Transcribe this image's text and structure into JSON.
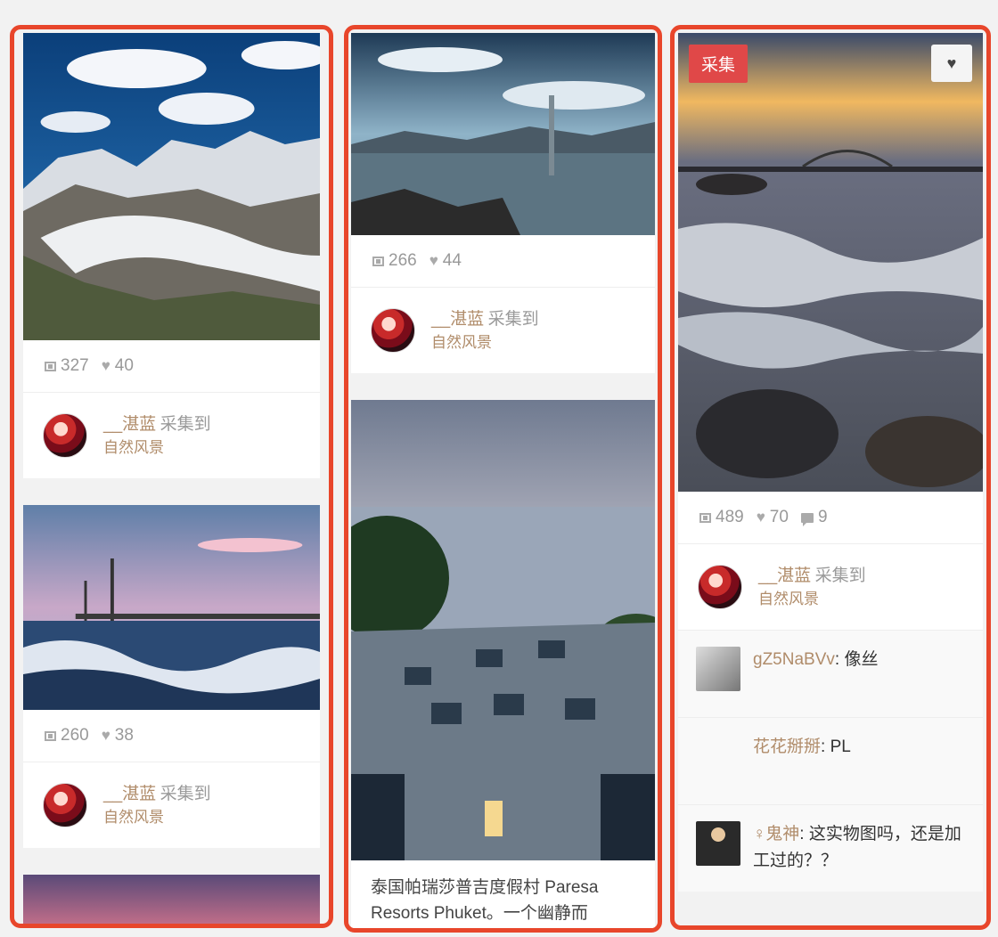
{
  "columns": [
    {
      "pins": [
        {
          "image": "alpine-glacier",
          "repins": "327",
          "likes": "40",
          "via_user": "__湛蓝",
          "via_action": "采集到",
          "board": "自然风景"
        },
        {
          "image": "stormy-pier",
          "repins": "260",
          "likes": "38",
          "via_user": "__湛蓝",
          "via_action": "采集到",
          "board": "自然风景"
        }
      ]
    },
    {
      "pins": [
        {
          "image": "lake-fork",
          "repins": "266",
          "likes": "44",
          "via_user": "__湛蓝",
          "via_action": "采集到",
          "board": "自然风景"
        },
        {
          "image": "phuket-deck",
          "description": "泰国帕瑞莎普吉度假村 Paresa Resorts Phuket。一个幽静而"
        }
      ]
    },
    {
      "pins": [
        {
          "image": "sydney-shore",
          "collect_label": "采集",
          "repins": "489",
          "likes": "70",
          "comments": "9",
          "via_user": "__湛蓝",
          "via_action": "采集到",
          "board": "自然风景",
          "comment_list": [
            {
              "user": "gZ5NaBVv",
              "text": "像丝"
            },
            {
              "user": "花花掰掰",
              "text": "PL"
            },
            {
              "user": "♀鬼神",
              "text": "这实物图吗，还是加工过的？？"
            }
          ]
        }
      ]
    }
  ],
  "icons": {
    "repin": "repin-icon",
    "like": "heart-icon",
    "comment": "comment-icon"
  },
  "colors": {
    "frame": "#e8462b",
    "collect": "#e04848",
    "username": "#b08c6a"
  }
}
